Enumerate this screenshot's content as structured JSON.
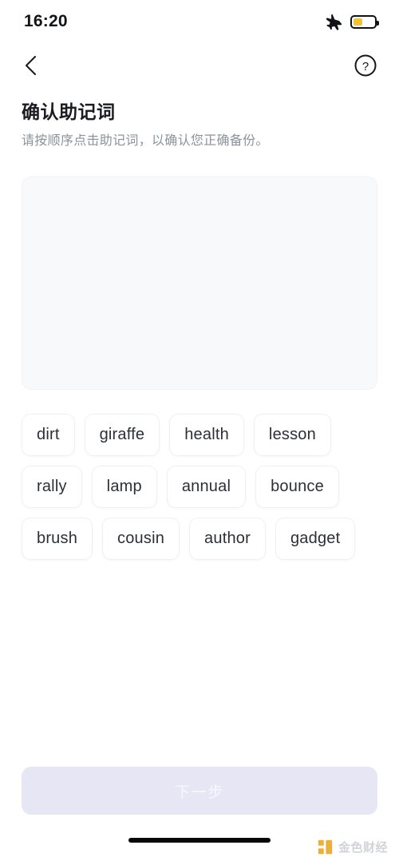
{
  "status_bar": {
    "time": "16:20",
    "airplane_icon": "airplane-mode-icon",
    "battery_icon": "battery-icon",
    "battery_level_percent": 45,
    "battery_color": "#F7C325"
  },
  "nav": {
    "back_icon": "chevron-left-icon",
    "help_icon": "question-circle-icon"
  },
  "header": {
    "title": "确认助记词",
    "subtitle": "请按顺序点击助记词，以确认您正确备份。"
  },
  "answer_panel": {
    "selected_words": [],
    "background_color": "#F8F9FA"
  },
  "word_bank": {
    "words": [
      "dirt",
      "giraffe",
      "health",
      "lesson",
      "rally",
      "lamp",
      "annual",
      "bounce",
      "brush",
      "cousin",
      "author",
      "gadget"
    ]
  },
  "cta": {
    "label": "下一步",
    "enabled": false,
    "background_color": "#E7E6F4",
    "text_color": "#F7F7FC"
  },
  "footer": {
    "home_indicator": "home-indicator",
    "watermark_text": "金色财经",
    "watermark_color": "#E8A317"
  }
}
